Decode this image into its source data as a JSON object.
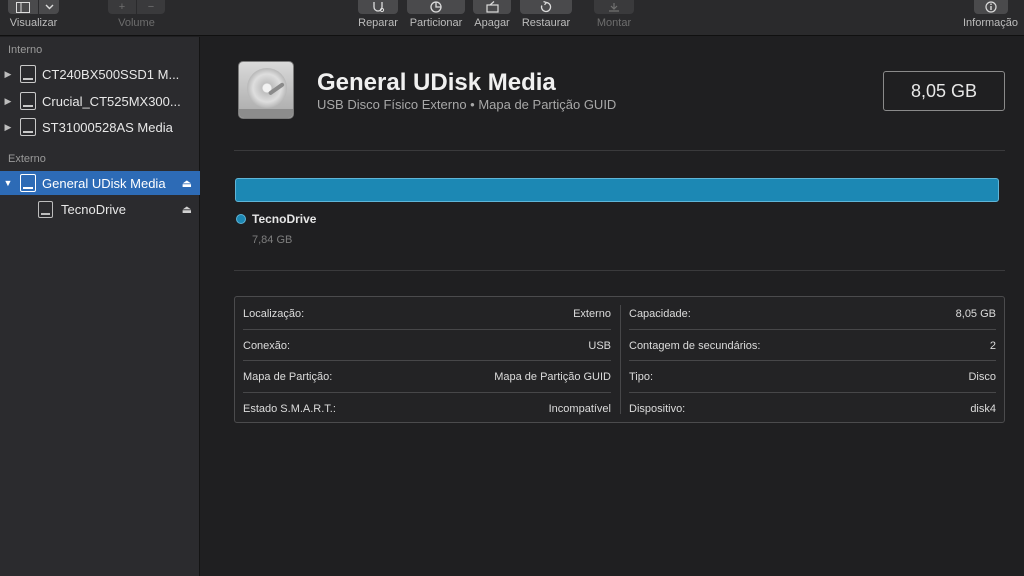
{
  "toolbar": {
    "view_label": "Visualizar",
    "volume_label": "Volume",
    "repair_label": "Reparar",
    "partition_label": "Particionar",
    "erase_label": "Apagar",
    "restore_label": "Restaurar",
    "mount_label": "Montar",
    "info_label": "Informação",
    "add_glyph": "+",
    "remove_glyph": "−"
  },
  "sidebar": {
    "internal_header": "Interno",
    "external_header": "Externo",
    "internal_items": [
      {
        "label": "CT240BX500SSD1 M..."
      },
      {
        "label": "Crucial_CT525MX300..."
      },
      {
        "label": "ST31000528AS Media"
      }
    ],
    "external_items": [
      {
        "label": "General UDisk Media",
        "selected": true
      },
      {
        "label": "TecnoDrive"
      }
    ]
  },
  "main": {
    "title": "General UDisk Media",
    "subtitle": "USB Disco Físico Externo • Mapa de Partição GUID",
    "capacity": "8,05 GB",
    "partition": {
      "name": "TecnoDrive",
      "size": "7,84 GB",
      "color": "#1c88b4",
      "fraction": 1.0
    },
    "info_left": [
      {
        "label": "Localização:",
        "value": "Externo"
      },
      {
        "label": "Conexão:",
        "value": "USB"
      },
      {
        "label": "Mapa de Partição:",
        "value": "Mapa de Partição GUID"
      },
      {
        "label": "Estado S.M.A.R.T.:",
        "value": "Incompatível"
      }
    ],
    "info_right": [
      {
        "label": "Capacidade:",
        "value": "8,05 GB"
      },
      {
        "label": "Contagem de secundários:",
        "value": "2"
      },
      {
        "label": "Tipo:",
        "value": "Disco"
      },
      {
        "label": "Dispositivo:",
        "value": "disk4"
      }
    ]
  },
  "colors": {
    "accent": "#2d6bb6",
    "partition": "#1c88b4"
  }
}
